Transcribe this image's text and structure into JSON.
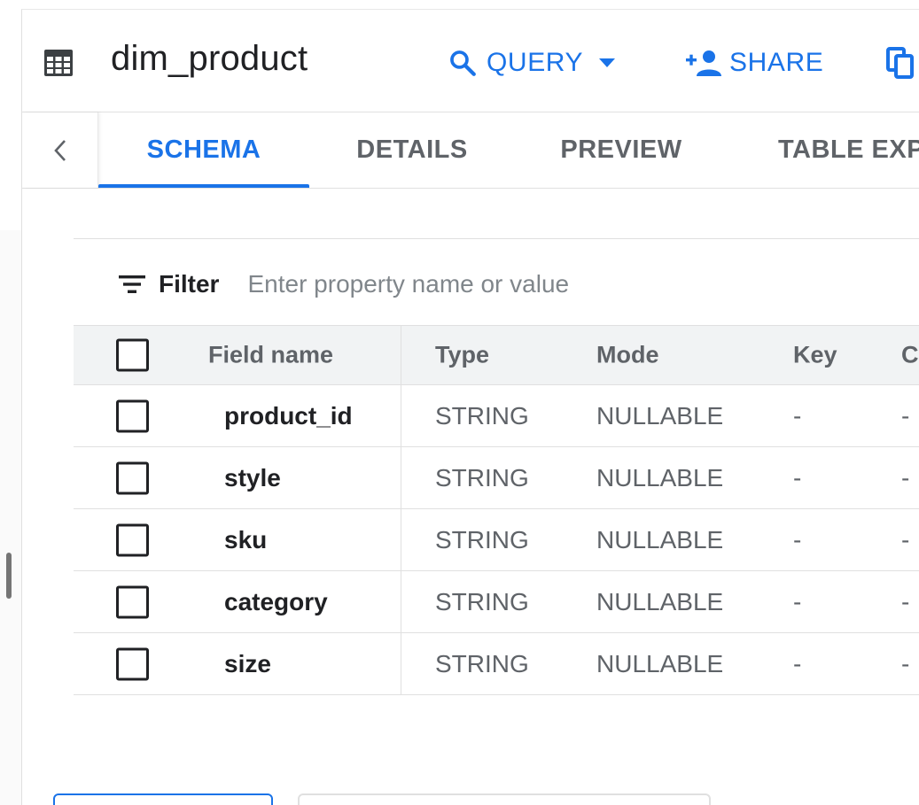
{
  "header": {
    "title": "dim_product",
    "query_label": "QUERY",
    "share_label": "SHARE"
  },
  "tabs": [
    {
      "label": "SCHEMA",
      "active": true
    },
    {
      "label": "DETAILS",
      "active": false
    },
    {
      "label": "PREVIEW",
      "active": false
    },
    {
      "label": "TABLE EXP",
      "active": false
    }
  ],
  "filter": {
    "label": "Filter",
    "placeholder": "Enter property name or value"
  },
  "schema": {
    "columns": [
      "Field name",
      "Type",
      "Mode",
      "Key",
      "C"
    ],
    "rows": [
      {
        "field": "product_id",
        "type": "STRING",
        "mode": "NULLABLE",
        "key": "-",
        "more": "-"
      },
      {
        "field": "style",
        "type": "STRING",
        "mode": "NULLABLE",
        "key": "-",
        "more": "-"
      },
      {
        "field": "sku",
        "type": "STRING",
        "mode": "NULLABLE",
        "key": "-",
        "more": "-"
      },
      {
        "field": "category",
        "type": "STRING",
        "mode": "NULLABLE",
        "key": "-",
        "more": "-"
      },
      {
        "field": "size",
        "type": "STRING",
        "mode": "NULLABLE",
        "key": "-",
        "more": "-"
      }
    ]
  },
  "icons": {
    "table": "table-grid-icon",
    "query": "search-icon",
    "share": "person-add-icon",
    "copy": "copy-icon",
    "back": "chevron-left-icon",
    "filter": "filter-lines-icon"
  },
  "colors": {
    "accent": "#1a73e8",
    "text": "#202124",
    "muted": "#5f6368",
    "header_bg": "#f1f3f4"
  }
}
